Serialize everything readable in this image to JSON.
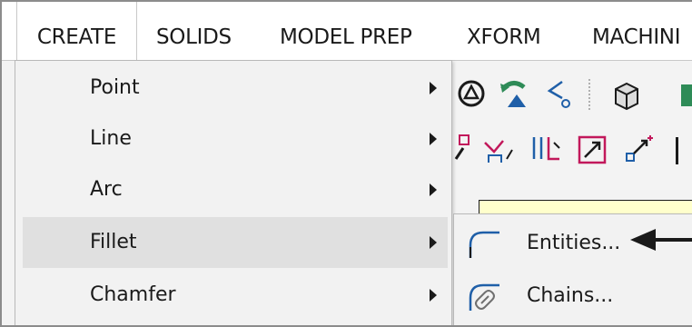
{
  "ribbon": {
    "tabs": [
      {
        "label": "CREATE",
        "active": true
      },
      {
        "label": "SOLIDS",
        "active": false
      },
      {
        "label": "MODEL PREP",
        "active": false
      },
      {
        "label": "XFORM",
        "active": false
      },
      {
        "label": "MACHINI",
        "active": false
      }
    ]
  },
  "create_menu": {
    "items": [
      {
        "label": "Point",
        "has_submenu": true,
        "highlighted": false
      },
      {
        "label": "Line",
        "has_submenu": true,
        "highlighted": false
      },
      {
        "label": "Arc",
        "has_submenu": true,
        "highlighted": false
      },
      {
        "label": "Fillet",
        "has_submenu": true,
        "highlighted": true
      },
      {
        "label": "Chamfer",
        "has_submenu": true,
        "highlighted": false
      }
    ]
  },
  "fillet_submenu": {
    "items": [
      {
        "label": "Entities...",
        "icon": "fillet-entities-icon"
      },
      {
        "label": "Chains...",
        "icon": "fillet-chains-icon"
      }
    ]
  },
  "colors": {
    "menu_background": "#f2f2f2",
    "highlight": "#e0e0e0",
    "input_field": "#ffffcc",
    "icon_blue": "#1f5fa8",
    "icon_magenta": "#c2185b",
    "icon_green": "#2e8b57"
  }
}
